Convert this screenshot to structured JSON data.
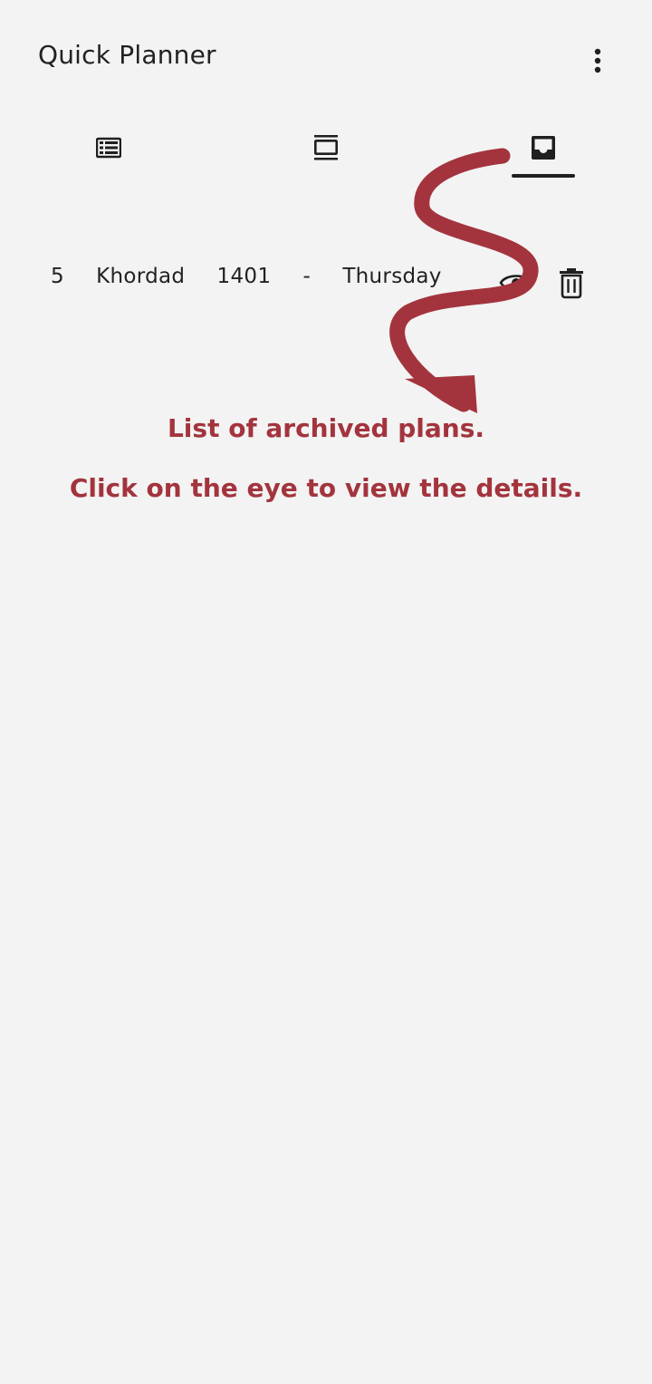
{
  "app": {
    "title": "Quick Planner"
  },
  "menu": {
    "icon": "more-vert-icon"
  },
  "tabs": [
    {
      "icon": "list-icon",
      "selected": false
    },
    {
      "icon": "carousel-icon",
      "selected": false
    },
    {
      "icon": "inbox-archive-icon",
      "selected": true
    }
  ],
  "plans": [
    {
      "date": "5  Khordad  1401  -  Thursday",
      "view_icon": "eye-icon",
      "delete_icon": "delete-icon"
    }
  ],
  "tutorial": {
    "line1": "List of archived plans.",
    "line2": "Click on the eye to view the details.",
    "color": "#a3343d"
  },
  "colors": {
    "background": "#f3f3f3",
    "text": "#1f1f1f",
    "accent": "#a3343d"
  }
}
